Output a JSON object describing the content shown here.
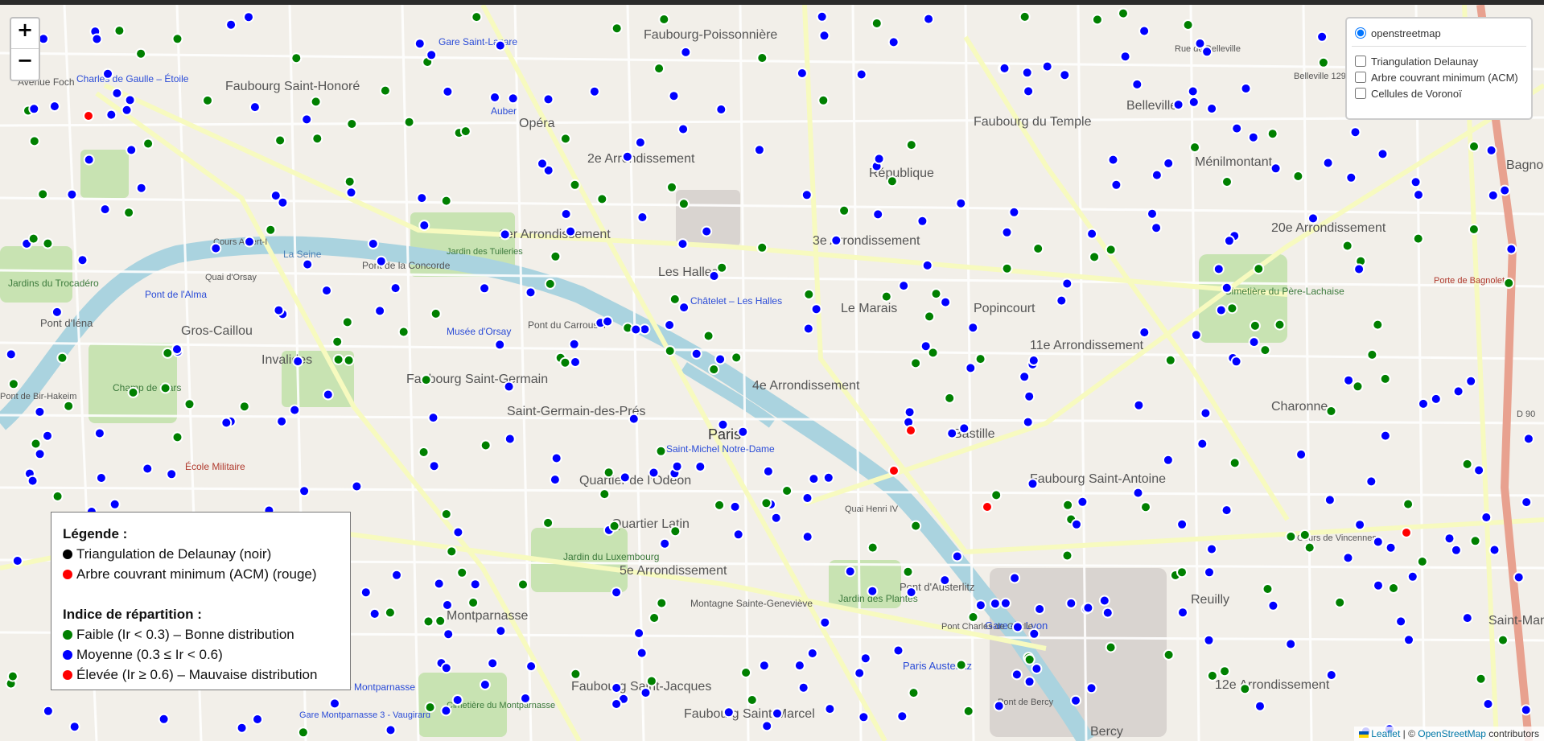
{
  "zoom": {
    "in_label": "+",
    "out_label": "−"
  },
  "layers": {
    "base": {
      "label": "openstreetmap",
      "selected": true
    },
    "overlays": [
      {
        "label": "Triangulation Delaunay",
        "checked": false
      },
      {
        "label": "Arbre couvrant minimum (ACM)",
        "checked": false
      },
      {
        "label": "Cellules de Voronoï",
        "checked": false
      }
    ]
  },
  "legend": {
    "title": "Légende :",
    "items": [
      {
        "label": "Triangulation de Delaunay (noir)",
        "color": "#000000"
      },
      {
        "label": "Arbre couvrant minimum (ACM) (rouge)",
        "color": "#ff0000"
      }
    ],
    "index_title": "Indice de répartition :",
    "index_items": [
      {
        "label": "Faible (Ir < 0.3) – Bonne distribution",
        "color": "#008000"
      },
      {
        "label": "Moyenne (0.3 ≤ Ir < 0.6)",
        "color": "#0000ff"
      },
      {
        "label": "Élevée (Ir ≥ 0.6) – Mauvaise distribution",
        "color": "#ff0000"
      }
    ]
  },
  "attribution": {
    "leaflet": "Leaflet",
    "sep": " | © ",
    "osm": "OpenStreetMap",
    "suffix": " contributors"
  },
  "map_labels": [
    "Faubourg Saint-Honoré",
    "Faubourg-Poissonnière",
    "Opéra",
    "2e Arrondissement",
    "République",
    "Faubourg du Temple",
    "Belleville",
    "Ménilmontant",
    "1er Arrondissement",
    "3e Arrondissement",
    "Les Halles",
    "Le Marais",
    "Popincourt",
    "11e Arrondissement",
    "20e Arrondissement",
    "Jardins du Trocadéro",
    "Pont d'Iéna",
    "Gros-Caillou",
    "Invalides",
    "Faubourg Saint-Germain",
    "Saint-Germain-des-Prés",
    "Paris",
    "4e Arrondissement",
    "Bastille",
    "Charonne",
    "Champ de Mars",
    "École Militaire",
    "Quartier de l'Odéon",
    "Quartier Latin",
    "Jardin du Luxembourg",
    "5e Arrondissement",
    "Faubourg Saint-Antoine",
    "Reuilly",
    "12e Arrondissement",
    "Montparnasse",
    "Faubourg Saint-Jacques",
    "Faubourg Saint-Marcel",
    "Montagne Sainte-Geneviève",
    "Jardin des Plantes",
    "Pont d'Austerlitz",
    "Gare de Lyon",
    "Paris Austerlitz",
    "Bercy",
    "Saint-Mandé",
    "Bagnolet",
    "Cimetière du Père-Lachaise",
    "Charles de Gaulle – Étoile",
    "Avenue Foch",
    "Cours Albert-I",
    "Quai d'Orsay",
    "Pont de la Concorde",
    "Jardin des Tuileries",
    "Musée d'Orsay",
    "Pont du Carrousel",
    "Châtelet – Les Halles",
    "Saint-Michel Notre-Dame",
    "Pont de l'Alma",
    "Cours de Vincennes",
    "Gare Montparnasse",
    "Cimetière du Montparnasse",
    "Gare Montparnasse 3 - Vaugirard",
    "Auber",
    "Gare Saint-Lazare",
    "Pont Charles de Gaulle",
    "Pont de Bercy",
    "Porte de Bagnolet",
    "Belleville 129 m",
    "Rue de Belleville",
    "Quai Henri IV",
    "La Seine",
    "D 90",
    "Pont de Bir-Hakeim"
  ],
  "points_note": "Station-like circle markers colored by Ir class",
  "counts": {
    "green": null,
    "blue": null,
    "red": 7
  }
}
